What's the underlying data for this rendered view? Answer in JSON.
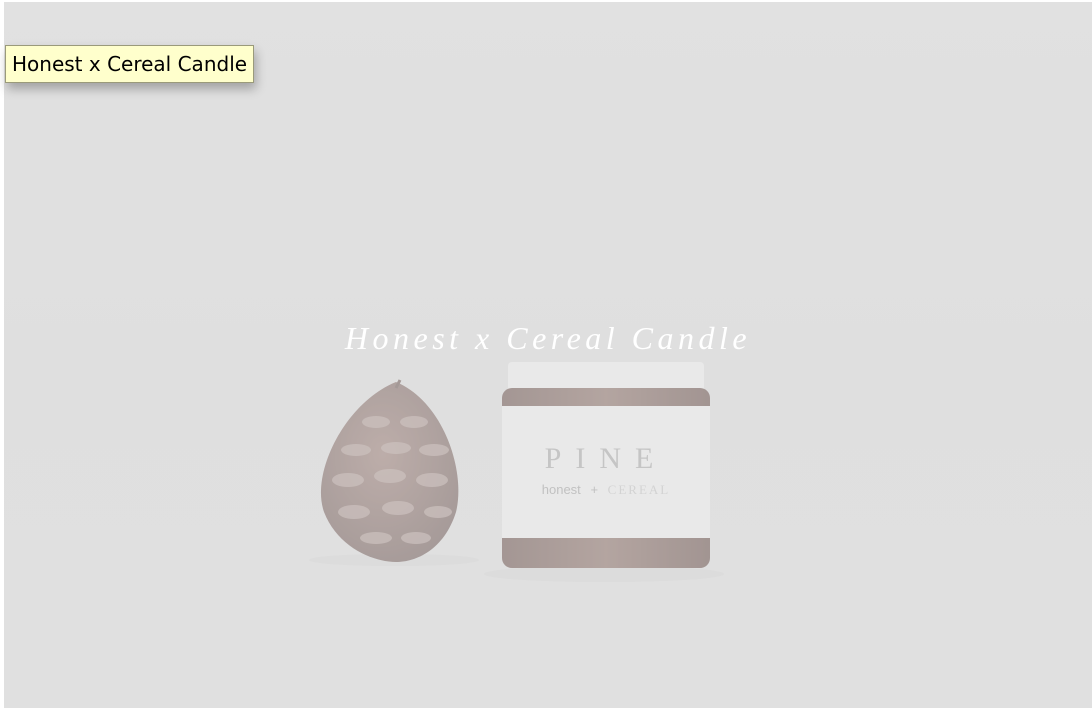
{
  "page": {
    "title": "Honest x Cereal Candle",
    "background_color": "#dadada"
  },
  "tooltip": {
    "text": "Honest x Cereal Candle",
    "background_color": "#ffffcc"
  },
  "product_image": {
    "icon": "pinecone-and-candle-jar-photo",
    "jar_label": {
      "scent": "PINE",
      "brand_left": "honest",
      "brand_joiner": "+",
      "brand_right": "CEREAL"
    }
  }
}
